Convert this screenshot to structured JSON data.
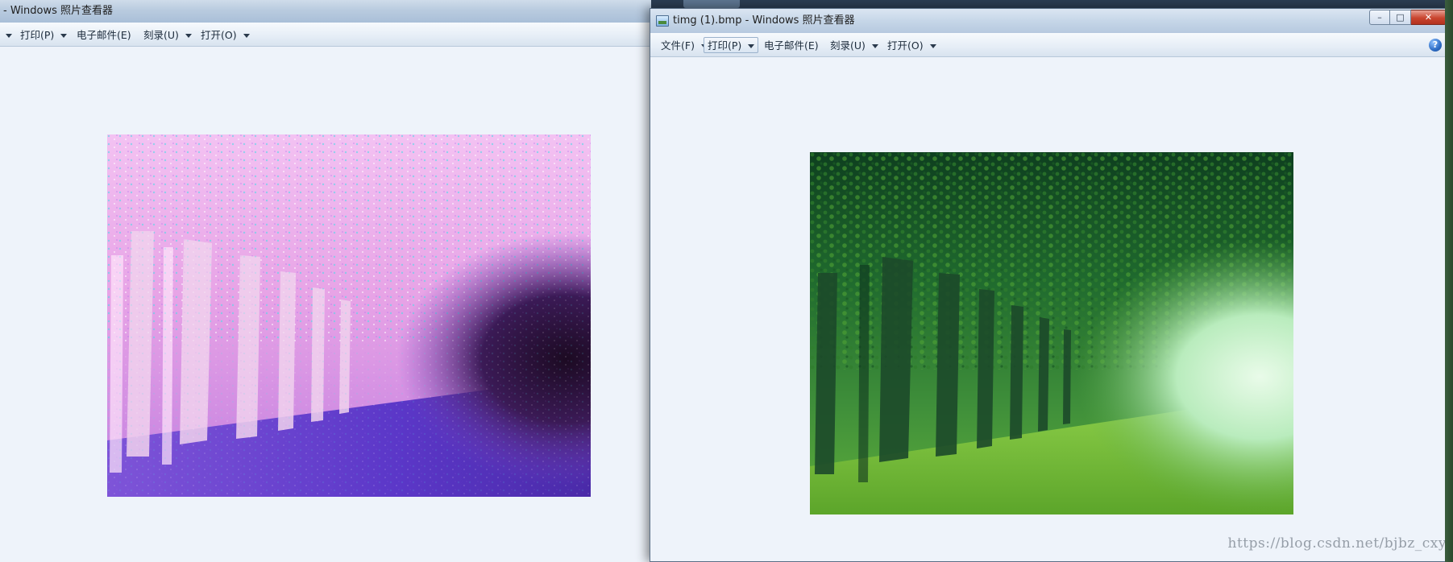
{
  "left_window": {
    "title": "- Windows 照片查看器",
    "menu": [
      {
        "label": "",
        "has_caret": true
      },
      {
        "label": "打印(P)",
        "has_caret": true
      },
      {
        "label": "电子邮件(E)",
        "has_caret": false
      },
      {
        "label": "刻录(U)",
        "has_caret": true
      },
      {
        "label": "打开(O)",
        "has_caret": true
      }
    ],
    "image": {
      "description_icon": "inverted-forest-photo"
    }
  },
  "right_window": {
    "title": "timg (1).bmp - Windows 照片查看器",
    "controls": {
      "minimize": "–",
      "maximize": "□",
      "close": "✕"
    },
    "menu": [
      {
        "label": "文件(F)",
        "has_caret": true
      },
      {
        "label": "打印(P)",
        "has_caret": true,
        "hover": true
      },
      {
        "label": "电子邮件(E)",
        "has_caret": false
      },
      {
        "label": "刻录(U)",
        "has_caret": true
      },
      {
        "label": "打开(O)",
        "has_caret": true
      }
    ],
    "help_glyph": "?",
    "image": {
      "description_icon": "green-forest-photo"
    },
    "watermark": "https://blog.csdn.net/bjbz_cxy"
  },
  "colors": {
    "inverted_pink": "#e9a6e8",
    "inverted_violet": "#6a3fd0",
    "forest_dark": "#124d2a",
    "forest_light": "#7bc73a",
    "viewer_bg": "#eef3fa"
  }
}
